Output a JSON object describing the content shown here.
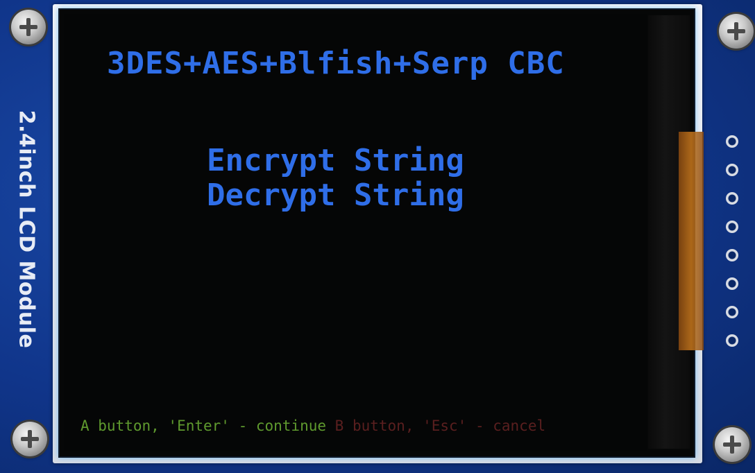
{
  "board": {
    "side_label": "2.4inch LCD Module"
  },
  "screen": {
    "title": "3DES+AES+Blfish+Serp CBC",
    "menu": [
      {
        "label": "Encrypt String"
      },
      {
        "label": "Decrypt String"
      }
    ],
    "footer": {
      "a_hint": "A button, 'Enter' - continue",
      "b_hint": "B button, 'Esc' - cancel"
    }
  },
  "colors": {
    "text_accent": "#2f6ee8",
    "a_hint": "#5f9a2e",
    "b_hint": "#5a1f1f",
    "pcb": "#10358a"
  },
  "icons": [
    "screw-icon",
    "pin-header-icon"
  ]
}
